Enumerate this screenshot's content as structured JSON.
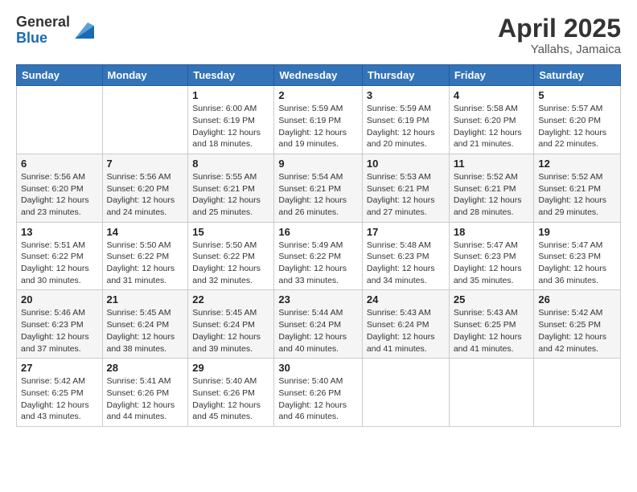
{
  "header": {
    "logo_general": "General",
    "logo_blue": "Blue",
    "title": "April 2025",
    "location": "Yallahs, Jamaica"
  },
  "weekdays": [
    "Sunday",
    "Monday",
    "Tuesday",
    "Wednesday",
    "Thursday",
    "Friday",
    "Saturday"
  ],
  "weeks": [
    [
      {
        "day": "",
        "info": ""
      },
      {
        "day": "",
        "info": ""
      },
      {
        "day": "1",
        "info": "Sunrise: 6:00 AM\nSunset: 6:19 PM\nDaylight: 12 hours and 18 minutes."
      },
      {
        "day": "2",
        "info": "Sunrise: 5:59 AM\nSunset: 6:19 PM\nDaylight: 12 hours and 19 minutes."
      },
      {
        "day": "3",
        "info": "Sunrise: 5:59 AM\nSunset: 6:19 PM\nDaylight: 12 hours and 20 minutes."
      },
      {
        "day": "4",
        "info": "Sunrise: 5:58 AM\nSunset: 6:20 PM\nDaylight: 12 hours and 21 minutes."
      },
      {
        "day": "5",
        "info": "Sunrise: 5:57 AM\nSunset: 6:20 PM\nDaylight: 12 hours and 22 minutes."
      }
    ],
    [
      {
        "day": "6",
        "info": "Sunrise: 5:56 AM\nSunset: 6:20 PM\nDaylight: 12 hours and 23 minutes."
      },
      {
        "day": "7",
        "info": "Sunrise: 5:56 AM\nSunset: 6:20 PM\nDaylight: 12 hours and 24 minutes."
      },
      {
        "day": "8",
        "info": "Sunrise: 5:55 AM\nSunset: 6:21 PM\nDaylight: 12 hours and 25 minutes."
      },
      {
        "day": "9",
        "info": "Sunrise: 5:54 AM\nSunset: 6:21 PM\nDaylight: 12 hours and 26 minutes."
      },
      {
        "day": "10",
        "info": "Sunrise: 5:53 AM\nSunset: 6:21 PM\nDaylight: 12 hours and 27 minutes."
      },
      {
        "day": "11",
        "info": "Sunrise: 5:52 AM\nSunset: 6:21 PM\nDaylight: 12 hours and 28 minutes."
      },
      {
        "day": "12",
        "info": "Sunrise: 5:52 AM\nSunset: 6:21 PM\nDaylight: 12 hours and 29 minutes."
      }
    ],
    [
      {
        "day": "13",
        "info": "Sunrise: 5:51 AM\nSunset: 6:22 PM\nDaylight: 12 hours and 30 minutes."
      },
      {
        "day": "14",
        "info": "Sunrise: 5:50 AM\nSunset: 6:22 PM\nDaylight: 12 hours and 31 minutes."
      },
      {
        "day": "15",
        "info": "Sunrise: 5:50 AM\nSunset: 6:22 PM\nDaylight: 12 hours and 32 minutes."
      },
      {
        "day": "16",
        "info": "Sunrise: 5:49 AM\nSunset: 6:22 PM\nDaylight: 12 hours and 33 minutes."
      },
      {
        "day": "17",
        "info": "Sunrise: 5:48 AM\nSunset: 6:23 PM\nDaylight: 12 hours and 34 minutes."
      },
      {
        "day": "18",
        "info": "Sunrise: 5:47 AM\nSunset: 6:23 PM\nDaylight: 12 hours and 35 minutes."
      },
      {
        "day": "19",
        "info": "Sunrise: 5:47 AM\nSunset: 6:23 PM\nDaylight: 12 hours and 36 minutes."
      }
    ],
    [
      {
        "day": "20",
        "info": "Sunrise: 5:46 AM\nSunset: 6:23 PM\nDaylight: 12 hours and 37 minutes."
      },
      {
        "day": "21",
        "info": "Sunrise: 5:45 AM\nSunset: 6:24 PM\nDaylight: 12 hours and 38 minutes."
      },
      {
        "day": "22",
        "info": "Sunrise: 5:45 AM\nSunset: 6:24 PM\nDaylight: 12 hours and 39 minutes."
      },
      {
        "day": "23",
        "info": "Sunrise: 5:44 AM\nSunset: 6:24 PM\nDaylight: 12 hours and 40 minutes."
      },
      {
        "day": "24",
        "info": "Sunrise: 5:43 AM\nSunset: 6:24 PM\nDaylight: 12 hours and 41 minutes."
      },
      {
        "day": "25",
        "info": "Sunrise: 5:43 AM\nSunset: 6:25 PM\nDaylight: 12 hours and 41 minutes."
      },
      {
        "day": "26",
        "info": "Sunrise: 5:42 AM\nSunset: 6:25 PM\nDaylight: 12 hours and 42 minutes."
      }
    ],
    [
      {
        "day": "27",
        "info": "Sunrise: 5:42 AM\nSunset: 6:25 PM\nDaylight: 12 hours and 43 minutes."
      },
      {
        "day": "28",
        "info": "Sunrise: 5:41 AM\nSunset: 6:26 PM\nDaylight: 12 hours and 44 minutes."
      },
      {
        "day": "29",
        "info": "Sunrise: 5:40 AM\nSunset: 6:26 PM\nDaylight: 12 hours and 45 minutes."
      },
      {
        "day": "30",
        "info": "Sunrise: 5:40 AM\nSunset: 6:26 PM\nDaylight: 12 hours and 46 minutes."
      },
      {
        "day": "",
        "info": ""
      },
      {
        "day": "",
        "info": ""
      },
      {
        "day": "",
        "info": ""
      }
    ]
  ]
}
